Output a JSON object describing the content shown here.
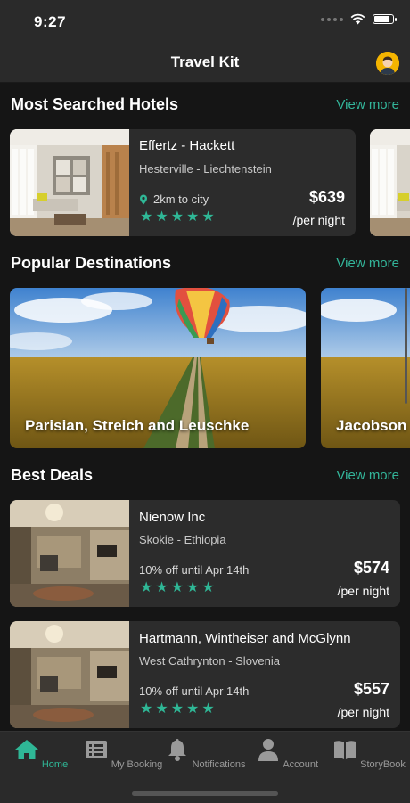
{
  "status": {
    "time": "9:27"
  },
  "app": {
    "title": "Travel Kit"
  },
  "sections": {
    "most_searched": {
      "title": "Most Searched Hotels",
      "view_more": "View more"
    },
    "popular": {
      "title": "Popular Destinations",
      "view_more": "View more"
    },
    "best_deals": {
      "title": "Best Deals",
      "view_more": "View more"
    }
  },
  "hotels": [
    {
      "name": "Effertz - Hackett",
      "location": "Hesterville - Liechtenstein",
      "distance": "2km to city",
      "price": "$639",
      "per": "/per night",
      "rating": 5
    }
  ],
  "destinations": [
    {
      "name": "Parisian, Streich and Leuschke"
    },
    {
      "name": "Jacobson"
    }
  ],
  "deals": [
    {
      "name": "Nienow Inc",
      "location": "Skokie - Ethiopia",
      "offer": "10% off until Apr 14th",
      "price": "$574",
      "per": "/per night",
      "rating": 5
    },
    {
      "name": "Hartmann, Wintheiser and McGlynn",
      "location": "West Cathrynton - Slovenia",
      "offer": "10% off until Apr 14th",
      "price": "$557",
      "per": "/per night",
      "rating": 5
    }
  ],
  "tabs": [
    {
      "label": "Home",
      "icon": "home-icon",
      "active": true
    },
    {
      "label": "My Booking",
      "icon": "booking-list-icon",
      "active": false
    },
    {
      "label": "Notifications",
      "icon": "bell-icon",
      "active": false
    },
    {
      "label": "Account",
      "icon": "user-icon",
      "active": false
    },
    {
      "label": "StoryBook",
      "icon": "book-icon",
      "active": false
    }
  ],
  "colors": {
    "accent": "#2fb796",
    "background": "#151515",
    "card": "#2c2c2c",
    "bar": "#2a2a2a"
  }
}
